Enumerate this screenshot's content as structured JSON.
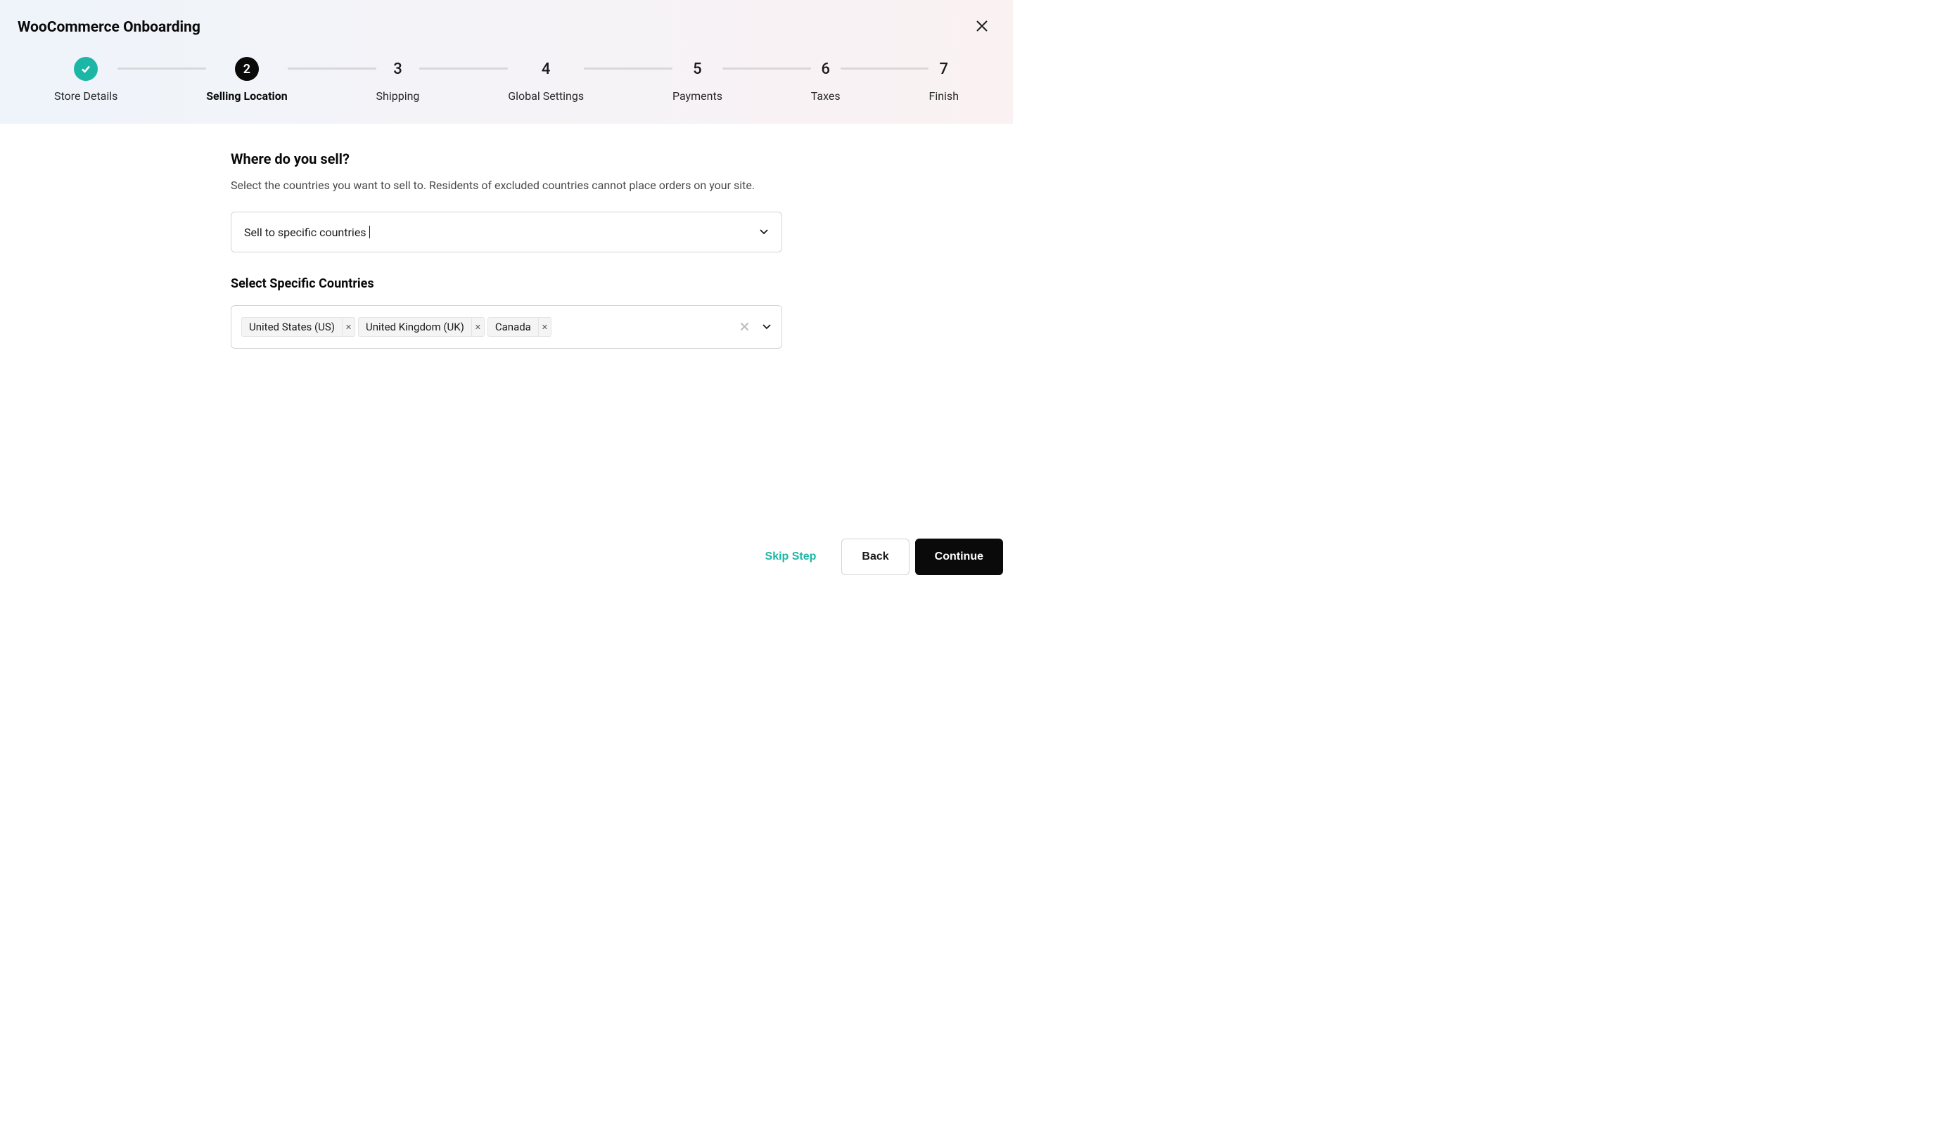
{
  "header": {
    "title": "WooCommerce Onboarding"
  },
  "stepper": {
    "steps": [
      {
        "label": "Store Details",
        "state": "complete"
      },
      {
        "label": "Selling Location",
        "number": "2",
        "state": "active"
      },
      {
        "label": "Shipping",
        "number": "3",
        "state": "pending"
      },
      {
        "label": "Global Settings",
        "number": "4",
        "state": "pending"
      },
      {
        "label": "Payments",
        "number": "5",
        "state": "pending"
      },
      {
        "label": "Taxes",
        "number": "6",
        "state": "pending"
      },
      {
        "label": "Finish",
        "number": "7",
        "state": "pending"
      }
    ]
  },
  "main": {
    "title": "Where do you sell?",
    "description": "Select the countries you want to sell to. Residents of excluded countries cannot place orders on your site.",
    "mode_select": {
      "value": "Sell to specific countries"
    },
    "countries_label": "Select Specific Countries",
    "selected_countries": [
      "United States (US)",
      "United Kingdom (UK)",
      "Canada"
    ]
  },
  "footer": {
    "skip": "Skip Step",
    "back": "Back",
    "continue": "Continue"
  }
}
